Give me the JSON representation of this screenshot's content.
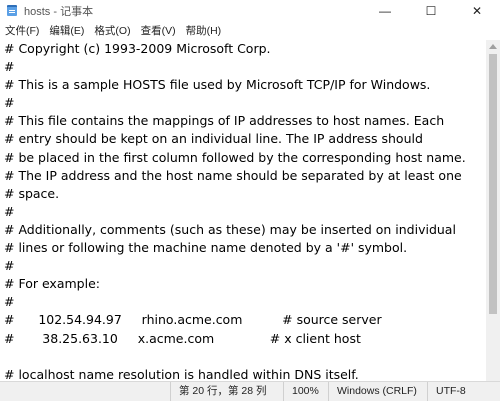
{
  "window": {
    "title": "hosts - 记事本",
    "minimize": "—",
    "maximize": "☐",
    "close": "✕"
  },
  "menu": [
    "文件(F)",
    "编辑(E)",
    "格式(O)",
    "查看(V)",
    "帮助(H)"
  ],
  "content": {
    "lines": [
      "# Copyright (c) 1993-2009 Microsoft Corp.",
      "#",
      "# This is a sample HOSTS file used by Microsoft TCP/IP for Windows.",
      "#",
      "# This file contains the mappings of IP addresses to host names. Each",
      "# entry should be kept on an individual line. The IP address should",
      "# be placed in the first column followed by the corresponding host name.",
      "# The IP address and the host name should be separated by at least one",
      "# space.",
      "#",
      "# Additionally, comments (such as these) may be inserted on individual",
      "# lines or following the machine name denoted by a '#' symbol.",
      "#",
      "# For example:",
      "#",
      "#      102.54.94.97     rhino.acme.com          # source server",
      "#       38.25.63.10     x.acme.com              # x client host",
      "",
      "# localhost name resolution is handled within DNS itself."
    ]
  },
  "status": {
    "position": "第 20 行，第 28 列",
    "zoom": "100%",
    "line_ending": "Windows (CRLF)",
    "encoding": "UTF-8"
  }
}
